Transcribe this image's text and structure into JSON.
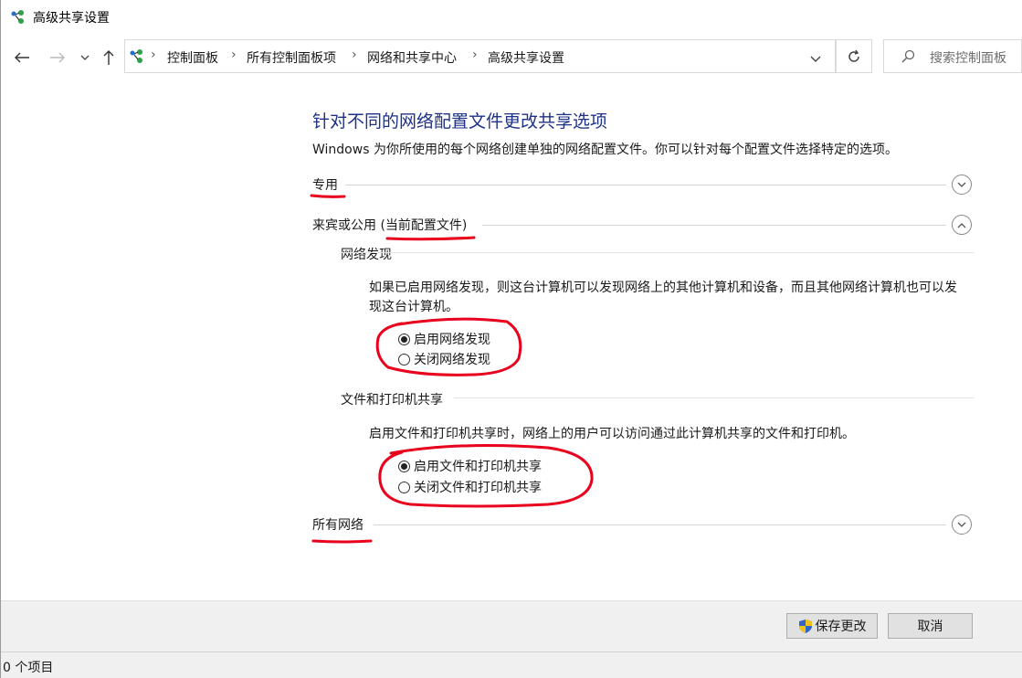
{
  "window": {
    "title": "高级共享设置",
    "icon": "network-sharing-icon"
  },
  "nav": {
    "back_icon": "back-arrow-icon",
    "forward_icon": "forward-arrow-icon",
    "recent_icon": "chevron-down-icon",
    "up_icon": "up-arrow-icon"
  },
  "breadcrumb": {
    "items": [
      "控制面板",
      "所有控制面板项",
      "网络和共享中心",
      "高级共享设置"
    ]
  },
  "search": {
    "placeholder": "搜索控制面板"
  },
  "page": {
    "heading": "针对不同的网络配置文件更改共享选项",
    "intro": "Windows 为你所使用的每个网络创建单独的网络配置文件。你可以针对每个配置文件选择特定的选项。"
  },
  "profiles": {
    "private": {
      "label": "专用",
      "expanded": false
    },
    "guest": {
      "label": "来宾或公用 (当前配置文件)",
      "expanded": true
    },
    "all": {
      "label": "所有网络",
      "expanded": false
    }
  },
  "network_discovery": {
    "title": "网络发现",
    "description": "如果已启用网络发现，则这台计算机可以发现网络上的其他计算机和设备，而且其他网络计算机也可以发现这台计算机。",
    "options": [
      {
        "label": "启用网络发现",
        "selected": true
      },
      {
        "label": "关闭网络发现",
        "selected": false
      }
    ]
  },
  "file_printer_sharing": {
    "title": "文件和打印机共享",
    "description": "启用文件和打印机共享时，网络上的用户可以访问通过此计算机共享的文件和打印机。",
    "options": [
      {
        "label": "启用文件和打印机共享",
        "selected": true
      },
      {
        "label": "关闭文件和打印机共享",
        "selected": false
      }
    ]
  },
  "footer": {
    "save_label": "保存更改",
    "save_icon": "uac-shield-icon",
    "cancel_label": "取消"
  },
  "status": {
    "text": "0 个项目"
  },
  "annotation_color": "#e8001c"
}
